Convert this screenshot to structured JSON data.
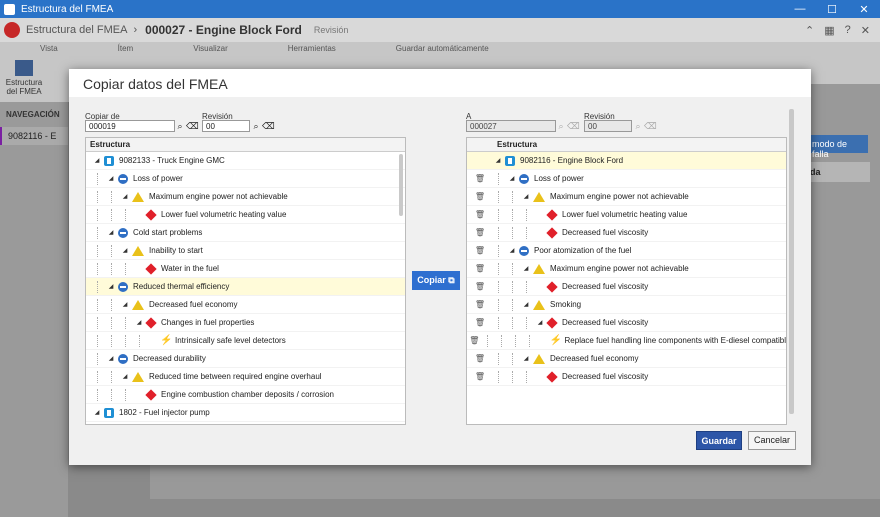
{
  "window": {
    "title": "Estructura del FMEA",
    "controls": [
      "—",
      "☐",
      "✕"
    ]
  },
  "app_header": {
    "module": "Estructura del FMEA",
    "record": "000027 - Engine Block Ford",
    "revision_label": "Revisión"
  },
  "ribbon": {
    "groups": [
      "Vista",
      "Ítem",
      "Visualizar",
      "Herramientas"
    ],
    "view_button": "Estructura del FMEA",
    "autosave": "Guardar automáticamente"
  },
  "nav": {
    "header": "NAVEGACIÓN",
    "item": "9082116 - E"
  },
  "background": {
    "button": "modo de falla",
    "column": "da"
  },
  "dialog": {
    "title": "Copiar datos del FMEA",
    "source": {
      "label": "Copiar de",
      "value": "000019",
      "revision_label": "Revisión",
      "revision_value": "00"
    },
    "target": {
      "label": "A",
      "value": "000027",
      "revision_label": "Revisión",
      "revision_value": "00"
    },
    "copy_button": "Copiar",
    "save_button": "Guardar",
    "cancel_button": "Cancelar",
    "structure_header": "Estructura",
    "source_tree": [
      {
        "label": "9082133 - Truck Engine GMC",
        "icon": "cube-icon",
        "depth": 0,
        "expanded": true,
        "highlight": false
      },
      {
        "label": "Loss of power",
        "icon": "function-icon",
        "depth": 1,
        "expanded": true,
        "highlight": false
      },
      {
        "label": "Maximum engine power not achievable",
        "icon": "warning-icon",
        "depth": 2,
        "expanded": true,
        "highlight": false
      },
      {
        "label": "Lower fuel volumetric heating value",
        "icon": "cause-icon",
        "depth": 3,
        "expanded": false,
        "highlight": false
      },
      {
        "label": "Cold start problems",
        "icon": "function-icon",
        "depth": 1,
        "expanded": true,
        "highlight": false
      },
      {
        "label": "Inability to start",
        "icon": "warning-icon",
        "depth": 2,
        "expanded": true,
        "highlight": false
      },
      {
        "label": "Water in the fuel",
        "icon": "cause-icon",
        "depth": 3,
        "expanded": false,
        "highlight": false
      },
      {
        "label": "Reduced thermal efficiency",
        "icon": "function-icon",
        "depth": 1,
        "expanded": true,
        "highlight": true
      },
      {
        "label": "Decreased fuel economy",
        "icon": "warning-icon",
        "depth": 2,
        "expanded": true,
        "highlight": false
      },
      {
        "label": "Changes in fuel properties",
        "icon": "cause-icon",
        "depth": 3,
        "expanded": true,
        "highlight": false
      },
      {
        "label": "Intrinsically safe level detectors",
        "icon": "control-icon",
        "depth": 4,
        "expanded": false,
        "highlight": false
      },
      {
        "label": "Decreased durability",
        "icon": "function-icon",
        "depth": 1,
        "expanded": true,
        "highlight": false
      },
      {
        "label": "Reduced time between required engine overhaul",
        "icon": "warning-icon",
        "depth": 2,
        "expanded": true,
        "highlight": false
      },
      {
        "label": "Engine combustion chamber deposits / corrosion",
        "icon": "cause-icon",
        "depth": 3,
        "expanded": false,
        "highlight": false
      },
      {
        "label": "1802 - Fuel injector pump",
        "icon": "cube-icon",
        "depth": 0,
        "expanded": true,
        "highlight": false
      }
    ],
    "target_tree": [
      {
        "label": "9082116 - Engine Block Ford",
        "icon": "cube-icon",
        "depth": 0,
        "expanded": true,
        "highlight": true,
        "deletable": false
      },
      {
        "label": "Loss of power",
        "icon": "function-icon",
        "depth": 1,
        "expanded": true,
        "highlight": false,
        "deletable": true
      },
      {
        "label": "Maximum engine power not achievable",
        "icon": "warning-icon",
        "depth": 2,
        "expanded": true,
        "highlight": false,
        "deletable": true
      },
      {
        "label": "Lower fuel volumetric heating value",
        "icon": "cause-icon",
        "depth": 3,
        "expanded": false,
        "highlight": false,
        "deletable": true
      },
      {
        "label": "Decreased fuel viscosity",
        "icon": "cause-icon",
        "depth": 3,
        "expanded": false,
        "highlight": false,
        "deletable": true
      },
      {
        "label": "Poor atomization of the fuel",
        "icon": "function-icon",
        "depth": 1,
        "expanded": true,
        "highlight": false,
        "deletable": true
      },
      {
        "label": "Maximum engine power not achievable",
        "icon": "warning-icon",
        "depth": 2,
        "expanded": true,
        "highlight": false,
        "deletable": true
      },
      {
        "label": "Decreased fuel viscosity",
        "icon": "cause-icon",
        "depth": 3,
        "expanded": false,
        "highlight": false,
        "deletable": true
      },
      {
        "label": "Smoking",
        "icon": "warning-icon",
        "depth": 2,
        "expanded": true,
        "highlight": false,
        "deletable": true
      },
      {
        "label": "Decreased fuel viscosity",
        "icon": "cause-icon",
        "depth": 3,
        "expanded": true,
        "highlight": false,
        "deletable": true
      },
      {
        "label": "Replace fuel handling line components with E-diesel compatibl",
        "icon": "control-icon",
        "depth": 4,
        "expanded": false,
        "highlight": false,
        "deletable": true
      },
      {
        "label": "Decreased fuel economy",
        "icon": "warning-icon",
        "depth": 2,
        "expanded": true,
        "highlight": false,
        "deletable": true
      },
      {
        "label": "Decreased fuel viscosity",
        "icon": "cause-icon",
        "depth": 3,
        "expanded": false,
        "highlight": false,
        "deletable": true
      }
    ]
  }
}
